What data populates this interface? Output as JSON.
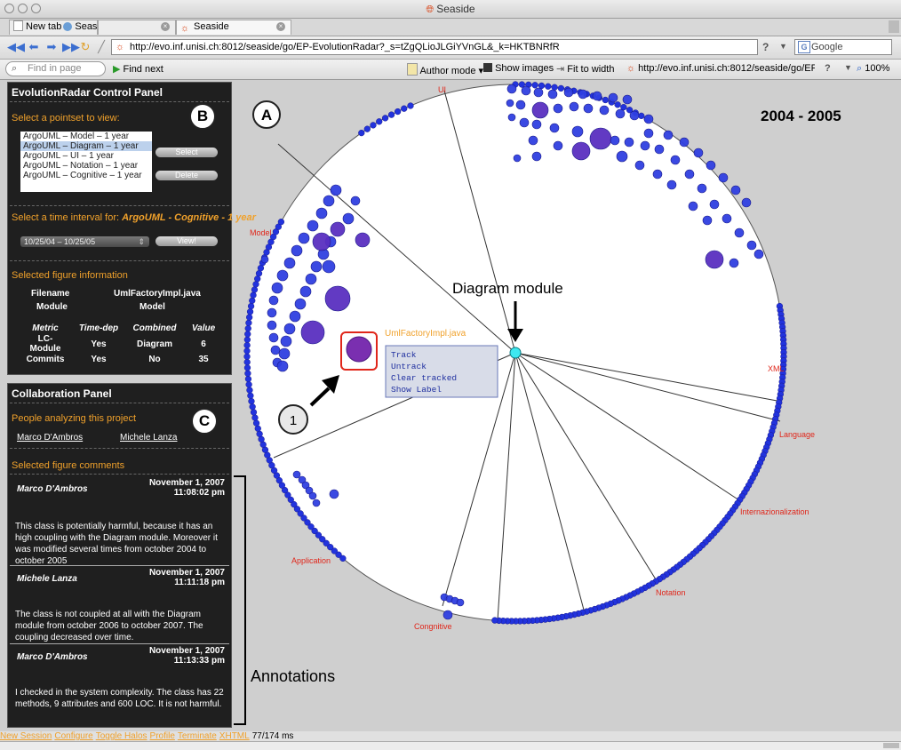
{
  "window": {
    "title": "Seaside"
  },
  "tabs": [
    {
      "label": "New tab"
    },
    {
      "label": "Seaside"
    },
    {
      "label": "Seaside"
    }
  ],
  "nav": {
    "url": "http://evo.inf.unisi.ch:8012/seaside/go/EP-EvolutionRadar?_s=tZgQLioJLGiYVnGL&_k=HKTBNRfR",
    "search_placeholder": "Google",
    "help_label": "?"
  },
  "findbar": {
    "find_placeholder": "Find in page",
    "find_next": "Find next",
    "author_mode": "Author mode",
    "show_images": "Show images",
    "fit_to_width": "Fit to width",
    "small_url": "http://evo.inf.unisi.ch:8012/seaside/go/EP-EvolutionF",
    "zoom": "100%"
  },
  "control_panel": {
    "title": "EvolutionRadar Control Panel",
    "pointset_heading": "Select a pointset to view:",
    "pointsets": [
      "ArgoUML – Model – 1 year",
      "ArgoUML – Diagram – 1 year",
      "ArgoUML – UI – 1 year",
      "ArgoUML – Notation – 1 year",
      "ArgoUML – Cognitive – 1 year"
    ],
    "select_label": "Select",
    "delete_label": "Delete",
    "interval_heading_prefix": "Select a time interval for: ",
    "interval_heading_value": "ArgoUML - Cognitive - 1 year",
    "interval_value": "10/25/04 – 10/25/05",
    "view_label": "View!",
    "figure_info_heading": "Selected figure information",
    "filename_label": "Filename",
    "filename_value": "UmlFactoryImpl.java",
    "module_label": "Module",
    "module_value": "Model",
    "table_headers": [
      "Metric",
      "Time-dep",
      "Combined",
      "Value"
    ],
    "table_rows": [
      [
        "LC-Module",
        "Yes",
        "Diagram",
        "6"
      ],
      [
        "Commits",
        "Yes",
        "No",
        "35"
      ]
    ]
  },
  "collab_panel": {
    "title": "Collaboration Panel",
    "people_heading": "People analyzing this project",
    "people": [
      "Marco D'Ambros",
      "Michele Lanza"
    ],
    "comments_heading": "Selected figure comments",
    "comments": [
      {
        "author": "Marco D'Ambros",
        "date": "November 1, 2007",
        "time": "11:08:02 pm",
        "text": "This class is potentially harmful, because it has an high coupling with the Diagram module. Moreover it was modified several times from october 2004 to october 2005"
      },
      {
        "author": "Michele Lanza",
        "date": "November 1, 2007",
        "time": "11:11:18 pm",
        "text": "The class is not coupled at all with the Diagram module from october 2006 to october 2007. The coupling decreased over time."
      },
      {
        "author": "Marco D'Ambros",
        "date": "November 1, 2007",
        "time": "11:13:33 pm",
        "text": "I checked in the system complexity. The class has 22 methods, 9 attributes and 600 LOC. It is not harmful."
      }
    ]
  },
  "radar": {
    "year_label": "2004 - 2005",
    "diagram_module_label": "Diagram module",
    "selected_file_label": "UmlFactoryImpl.java",
    "modules": [
      "UI",
      "Model",
      "XML",
      "Language",
      "Internazionalization",
      "Notation",
      "Congnitive",
      "Application"
    ],
    "context_menu": [
      "Track",
      "Untrack",
      "Clear tracked",
      "Show Label"
    ]
  },
  "annotations": {
    "a": "A",
    "b": "B",
    "c": "C",
    "one": "1",
    "annotations_label": "Annotations"
  },
  "status_bar": {
    "links": [
      "New Session",
      "Configure",
      "Toggle Halos",
      "Profile",
      "Terminate",
      "XHTML"
    ],
    "timing": "77/174 ms"
  },
  "colors": {
    "orange": "#f0a12b",
    "panel": "#1f1f1f",
    "dot_blue": "#2233dd",
    "dot_purple": "#5a2fc0",
    "cyan": "#3ee8f0",
    "red": "#e0261a"
  }
}
